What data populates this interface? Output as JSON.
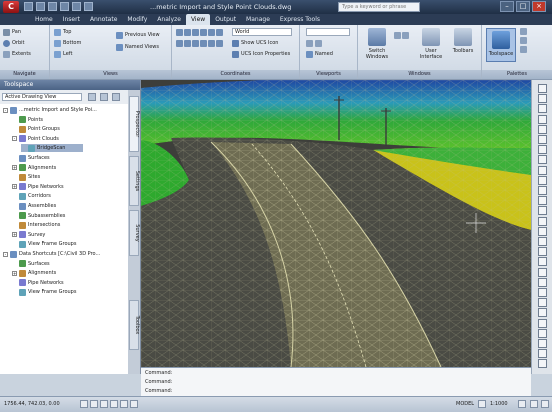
{
  "title_bar": {
    "app_logo": "C",
    "document_title": "...metric Import and Style Point Clouds.dwg",
    "search_placeholder": "Type a keyword or phrase"
  },
  "ribbon_tabs": [
    {
      "label": "Home",
      "active": false
    },
    {
      "label": "Insert",
      "active": false
    },
    {
      "label": "Annotate",
      "active": false
    },
    {
      "label": "Modify",
      "active": false
    },
    {
      "label": "Analyze",
      "active": false
    },
    {
      "label": "View",
      "active": true
    },
    {
      "label": "Output",
      "active": false
    },
    {
      "label": "Manage",
      "active": false
    },
    {
      "label": "Express Tools",
      "active": false
    }
  ],
  "ribbon": {
    "navigate": {
      "title": "Navigate",
      "pan": "Pan",
      "orbit": "Orbit",
      "extents": "Extents"
    },
    "views": {
      "title": "Views",
      "items": [
        "Top",
        "Bottom",
        "Left"
      ],
      "previous_view": "Previous View",
      "named_views": "Named Views"
    },
    "coordinates": {
      "title": "Coordinates",
      "ucs_select": "World",
      "show_ucs_icon": "Show UCS Icon",
      "ucs_icon_properties": "UCS Icon Properties"
    },
    "viewports": {
      "title": "Viewports",
      "named": "Named"
    },
    "windows": {
      "title": "Windows",
      "switch_windows": "Switch Windows",
      "user_interface": "User Interface",
      "toolbars": "Toolbars"
    },
    "palettes": {
      "title": "Palettes",
      "toolspace": "Toolspace"
    }
  },
  "toolspace": {
    "title": "Toolspace",
    "view_select": "Active Drawing View",
    "side_tabs": [
      "Prospector",
      "Settings",
      "Survey",
      "Toolbox"
    ],
    "tree": [
      {
        "label": "...metric Import and Style Poi...",
        "level": 0,
        "expander": "-"
      },
      {
        "label": "Points",
        "level": 1,
        "expander": ""
      },
      {
        "label": "Point Groups",
        "level": 1,
        "expander": ""
      },
      {
        "label": "Point Clouds",
        "level": 1,
        "expander": "-"
      },
      {
        "label": "BridgeScan",
        "level": 2,
        "expander": "",
        "selected": true
      },
      {
        "label": "Surfaces",
        "level": 1,
        "expander": ""
      },
      {
        "label": "Alignments",
        "level": 1,
        "expander": "+"
      },
      {
        "label": "Sites",
        "level": 1,
        "expander": ""
      },
      {
        "label": "Pipe Networks",
        "level": 1,
        "expander": "+"
      },
      {
        "label": "Corridors",
        "level": 1,
        "expander": ""
      },
      {
        "label": "Assemblies",
        "level": 1,
        "expander": ""
      },
      {
        "label": "Subassemblies",
        "level": 1,
        "expander": ""
      },
      {
        "label": "Intersections",
        "level": 1,
        "expander": ""
      },
      {
        "label": "Survey",
        "level": 1,
        "expander": "+"
      },
      {
        "label": "View Frame Groups",
        "level": 1,
        "expander": ""
      },
      {
        "label": "Data Shortcuts [C:\\Civil 3D Pro...",
        "level": 0,
        "expander": "-"
      },
      {
        "label": "Surfaces",
        "level": 1,
        "expander": ""
      },
      {
        "label": "Alignments",
        "level": 1,
        "expander": "+"
      },
      {
        "label": "Pipe Networks",
        "level": 1,
        "expander": ""
      },
      {
        "label": "View Frame Groups",
        "level": 1,
        "expander": ""
      }
    ]
  },
  "command_line": {
    "lines": [
      "Command:",
      "Command:",
      "Command:"
    ]
  },
  "status_bar": {
    "coordinates": "1756.44, 742.03, 0.00",
    "model": "MODEL",
    "scale": "1:1000"
  },
  "colors": {
    "accent": "#4b6385",
    "terrain_green": "#3faa2a",
    "terrain_yellow": "#c9c21a",
    "road_mesh": "#b9b78a"
  }
}
